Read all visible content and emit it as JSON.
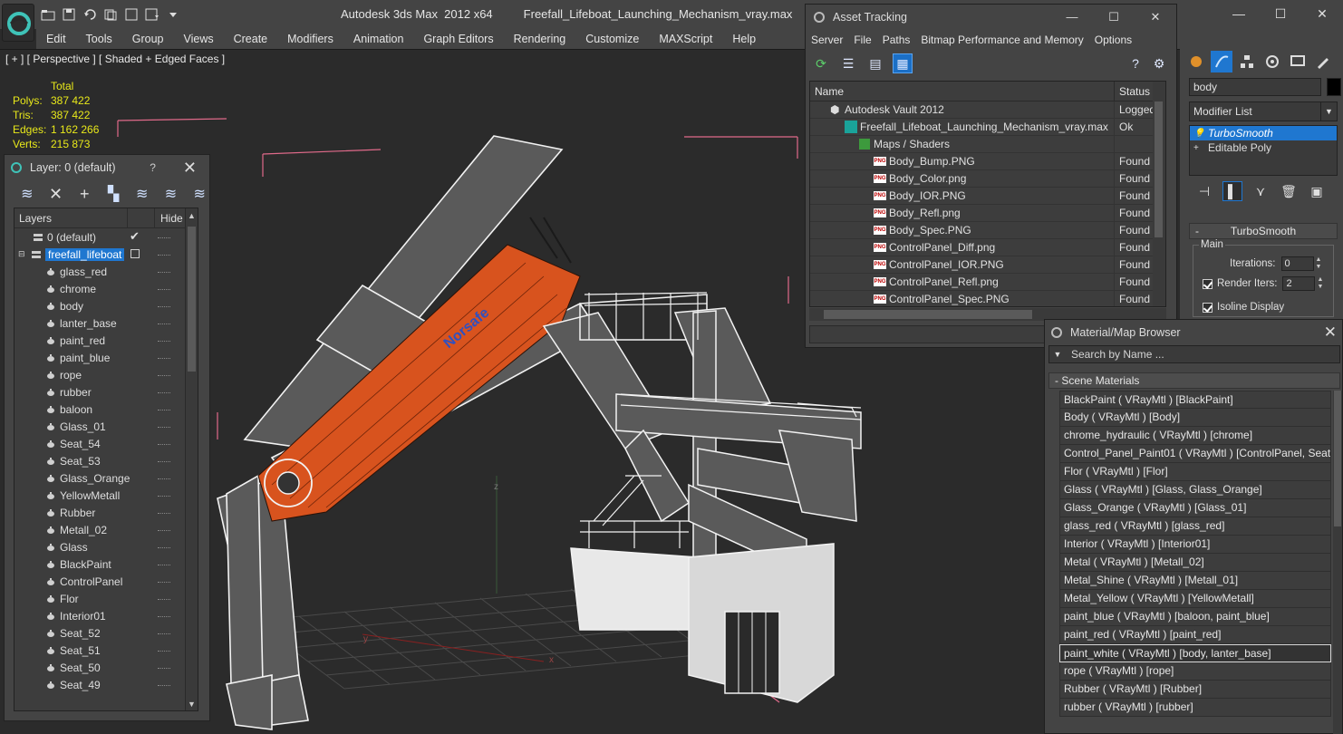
{
  "window": {
    "app_title": "Autodesk 3ds Max  2012 x64",
    "file_title": "Freefall_Lifeboat_Launching_Mechanism_vray.max",
    "minimize": "—",
    "maximize": "☐",
    "close": "✕"
  },
  "menu": [
    "Edit",
    "Tools",
    "Group",
    "Views",
    "Create",
    "Modifiers",
    "Animation",
    "Graph Editors",
    "Rendering",
    "Customize",
    "MAXScript",
    "Help"
  ],
  "viewport": {
    "label": "[ + ] [ Perspective ] [ Shaded + Edged Faces ]",
    "stats_header": "Total",
    "stats": [
      {
        "key": "Polys:",
        "value": "387 422"
      },
      {
        "key": "Tris:",
        "value": "387 422"
      },
      {
        "key": "Edges:",
        "value": "1 162 266"
      },
      {
        "key": "Verts:",
        "value": "215 873"
      }
    ],
    "boat_text": "Norsafe",
    "axis_z": "z",
    "axis_y": "y",
    "axis_x": "x"
  },
  "layer_panel": {
    "title": "Layer: 0 (default)",
    "help": "?",
    "close": "✕",
    "col_layers": "Layers",
    "col_hide": "Hide",
    "default_layer": "0 (default)",
    "active_layer": "freefall_lifeboat",
    "items": [
      "glass_red",
      "chrome",
      "body",
      "lanter_base",
      "paint_red",
      "paint_blue",
      "rope",
      "rubber",
      "baloon",
      "Glass_01",
      "Seat_54",
      "Seat_53",
      "Glass_Orange",
      "YellowMetall",
      "Rubber",
      "Metall_02",
      "Glass",
      "BlackPaint",
      "ControlPanel",
      "Flor",
      "Interior01",
      "Seat_52",
      "Seat_51",
      "Seat_50",
      "Seat_49"
    ]
  },
  "asset_tracking": {
    "title": "Asset Tracking",
    "menu": [
      "Server",
      "File",
      "Paths",
      "Bitmap Performance and Memory",
      "Options"
    ],
    "col_name": "Name",
    "col_status": "Status",
    "rows": [
      {
        "name": "Autodesk Vault 2012",
        "status": "Logged",
        "level": 1,
        "icon": "vault"
      },
      {
        "name": "Freefall_Lifeboat_Launching_Mechanism_vray.max",
        "status": "Ok",
        "level": 2,
        "icon": "max"
      },
      {
        "name": "Maps / Shaders",
        "status": "",
        "level": 3,
        "icon": "maps"
      },
      {
        "name": "Body_Bump.PNG",
        "status": "Found",
        "level": 4,
        "icon": "png"
      },
      {
        "name": "Body_Color.png",
        "status": "Found",
        "level": 4,
        "icon": "png"
      },
      {
        "name": "Body_IOR.PNG",
        "status": "Found",
        "level": 4,
        "icon": "png"
      },
      {
        "name": "Body_Refl.png",
        "status": "Found",
        "level": 4,
        "icon": "png"
      },
      {
        "name": "Body_Spec.PNG",
        "status": "Found",
        "level": 4,
        "icon": "png"
      },
      {
        "name": "ControlPanel_Diff.png",
        "status": "Found",
        "level": 4,
        "icon": "png"
      },
      {
        "name": "ControlPanel_IOR.PNG",
        "status": "Found",
        "level": 4,
        "icon": "png"
      },
      {
        "name": "ControlPanel_Refl.png",
        "status": "Found",
        "level": 4,
        "icon": "png"
      },
      {
        "name": "ControlPanel_Spec.PNG",
        "status": "Found",
        "level": 4,
        "icon": "png"
      }
    ]
  },
  "command_panel": {
    "object_name": "body",
    "modifier_list": "Modifier List",
    "stack": [
      "TurboSmooth",
      "Editable Poly"
    ],
    "rollout_title": "TurboSmooth",
    "rollout_toggle": "-",
    "group_main": "Main",
    "iterations_label": "Iterations:",
    "iterations_value": "0",
    "render_iters_label": "Render Iters:",
    "render_iters_value": "2",
    "isoline_label": "Isoline Display"
  },
  "material_browser": {
    "title": "Material/Map Browser",
    "search_placeholder": "Search by Name ...",
    "group": "- Scene Materials",
    "items": [
      "BlackPaint  ( VRayMtl ) [BlackPaint]",
      "Body  ( VRayMtl ) [Body]",
      "chrome_hydraulic  ( VRayMtl ) [chrome]",
      "Control_Panel_Paint01  ( VRayMtl ) [ControlPanel, Seat...",
      "Flor  ( VRayMtl ) [Flor]",
      "Glass  ( VRayMtl ) [Glass, Glass_Orange]",
      "Glass_Orange  ( VRayMtl ) [Glass_01]",
      "glass_red  ( VRayMtl ) [glass_red]",
      "Interior  ( VRayMtl ) [Interior01]",
      "Metal  ( VRayMtl ) [Metall_02]",
      "Metal_Shine  ( VRayMtl ) [Metall_01]",
      "Metal_Yellow  ( VRayMtl ) [YellowMetall]",
      "paint_blue  ( VRayMtl ) [baloon, paint_blue]",
      "paint_red  ( VRayMtl ) [paint_red]",
      "paint_white  ( VRayMtl ) [body, lanter_base]",
      "rope  ( VRayMtl ) [rope]",
      "Rubber  ( VRayMtl ) [Rubber]",
      "rubber  ( VRayMtl ) [rubber]"
    ],
    "selected_index": 14
  },
  "colors": {
    "ui_bg": "#444444",
    "viewport_bg": "#2b2b2b",
    "selection_blue": "#1f77d0",
    "stats_yellow": "#e8e81a",
    "boat_orange": "#d8531e"
  }
}
